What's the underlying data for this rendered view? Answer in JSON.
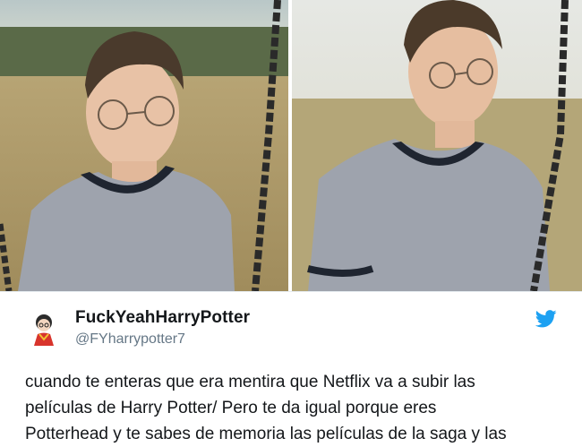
{
  "tweet": {
    "display_name": "FuckYeahHarryPotter",
    "handle": "@FYharrypotter7",
    "text_lines": [
      "cuando te enteras que era mentira que Netflix va a subir las",
      "películas de Harry Potter/ Pero te da igual porque eres",
      "Potterhead y te sabes de memoria las películas de la saga y las"
    ]
  },
  "icons": {
    "platform": "bird-icon",
    "avatar": "cartoon-avatar"
  },
  "colors": {
    "name": "#14171a",
    "handle": "#657786",
    "bird": "#1da1f2",
    "shirt": "#9ea3ad",
    "collar": "#1f2530"
  }
}
